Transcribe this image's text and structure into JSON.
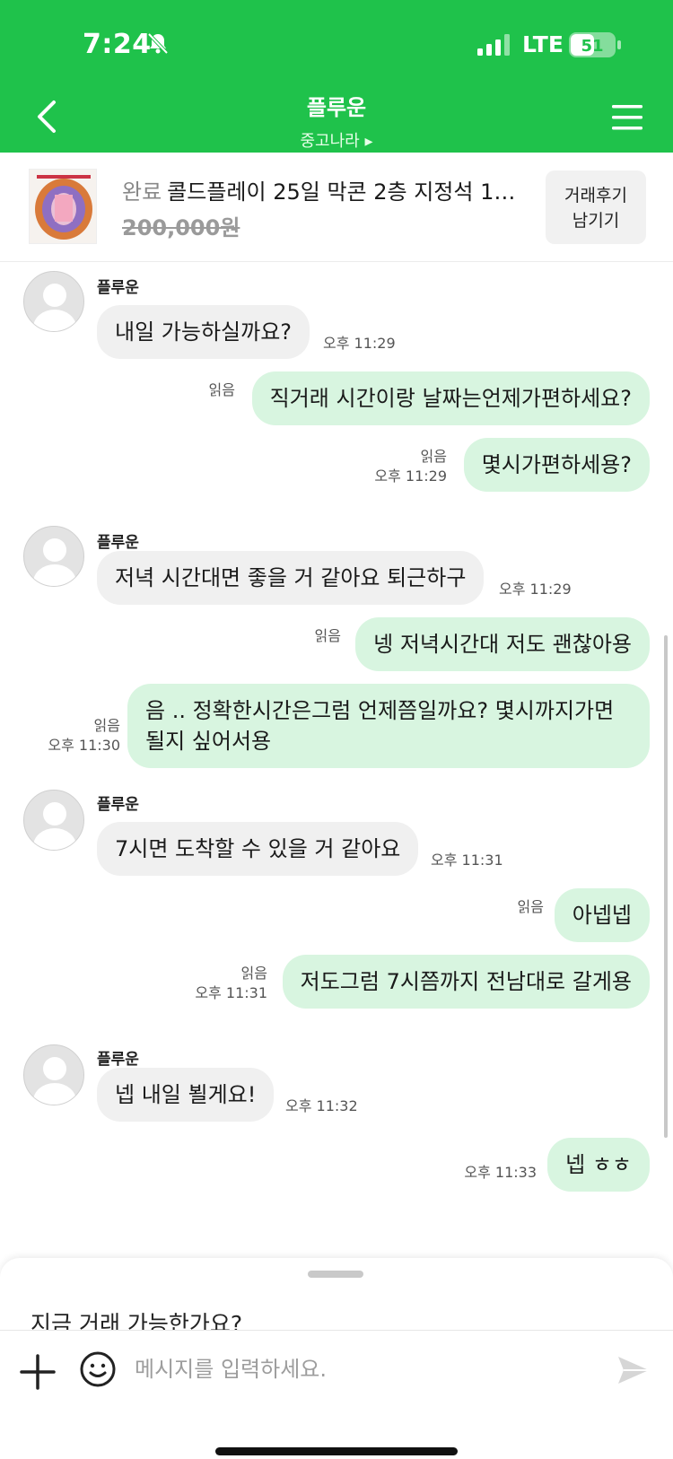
{
  "status_bar": {
    "time": "7:24",
    "network": "LTE",
    "battery": "51"
  },
  "header": {
    "title": "플루운",
    "subtitle": "중고나라 ▸"
  },
  "product": {
    "status": "완료",
    "title": "콜드플레이 25일 막콘 2층 지정석 1…",
    "price": "200,000원",
    "review_button": [
      "거래후기",
      "남기기"
    ]
  },
  "messages": [
    {
      "sender": "플루운",
      "text": "내일 가능하실까요?",
      "time": "오후 11:29"
    },
    {
      "read": "읽음",
      "text": "직거래 시간이랑 날짜는언제가편하세요?"
    },
    {
      "read": "읽음",
      "time": "오후 11:29",
      "text": "몇시가편하세용?"
    },
    {
      "sender": "플루운",
      "text": "저녁 시간대면 좋을 거 같아요 퇴근하구",
      "time": "오후 11:29"
    },
    {
      "read": "읽음",
      "text": "넹 저녁시간대 저도 괜찮아용"
    },
    {
      "read": "읽음",
      "time": "오후 11:30",
      "text": "음 .. 정확한시간은그럼 언제쯤일까요? 몇시까지가면 될지 싶어서용"
    },
    {
      "sender": "플루운",
      "text": "7시면 도착할 수 있을 거 같아요",
      "time": "오후 11:31"
    },
    {
      "read": "읽음",
      "text": "아넵넵"
    },
    {
      "read": "읽음",
      "time": "오후 11:31",
      "text": "저도그럼 7시쯤까지 전남대로 갈게용"
    },
    {
      "sender": "플루운",
      "text": "넵 내일 뵐게요!",
      "time": "오후 11:32"
    },
    {
      "time": "오후 11:33",
      "text": "넵 ㅎㅎ"
    }
  ],
  "suggestion": "지금 거래 가능한가요?",
  "input": {
    "placeholder": "메시지를 입력하세요."
  },
  "colors": {
    "brand_green": "#1fc24b",
    "outgoing_bubble": "#d8f5e0",
    "incoming_bubble": "#f0f0f0"
  }
}
